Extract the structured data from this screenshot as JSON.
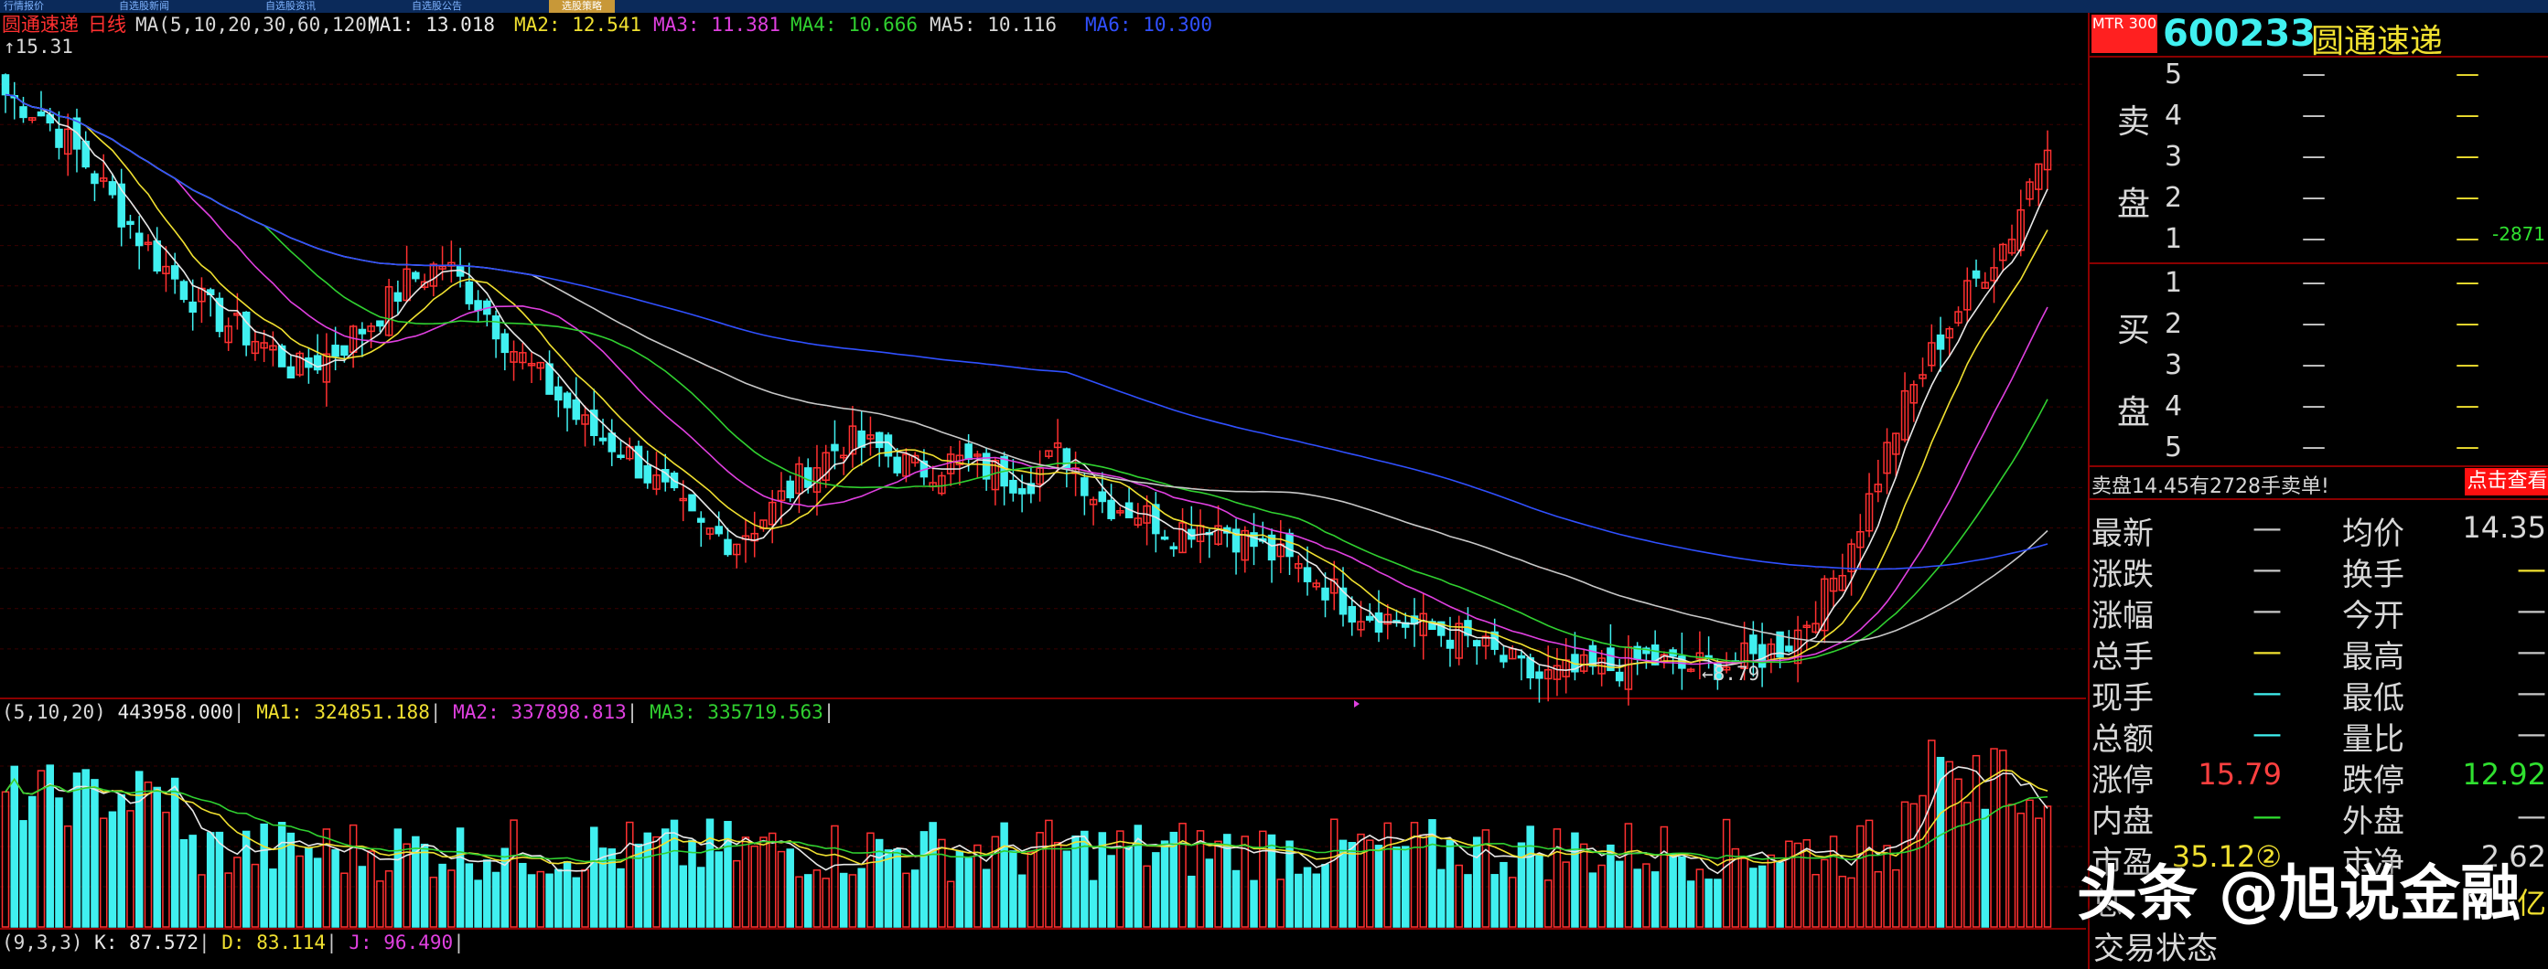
{
  "top_tabs": [
    "行情报价",
    "自选股新闻",
    "自选股资讯",
    "自选股公告",
    "选股策略"
  ],
  "main_legend": {
    "stock": "圆通速递",
    "period": "日线",
    "ma_def": "MA(5,10,20,30,60,120)",
    "ma1": "MA1: 13.018",
    "ma2": "MA2: 12.541",
    "ma3": "MA3: 11.381",
    "ma4": "MA4: 10.666",
    "ma5": "MA5: 10.116",
    "ma6": "MA6: 10.300"
  },
  "price_marks": {
    "high": "15.31",
    "low": "8.79"
  },
  "vol_legend": {
    "def": "(5,10,20)",
    "vol": "443958.000",
    "ma1": "MA1: 324851.188",
    "ma2": "MA2: 337898.813",
    "ma3": "MA3: 335719.563"
  },
  "kdj_legend": {
    "def": "(9,3,3)",
    "k": "K: 87.572",
    "d": "D: 83.114",
    "j": "J: 96.490"
  },
  "colors": {
    "up": "#ff3030",
    "down": "#40f0f0",
    "ma1": "#e8e8e8",
    "ma2": "#f0e030",
    "ma3": "#e040e0",
    "ma4": "#30d030",
    "ma5": "#c8c8c8",
    "ma6": "#3050ff"
  },
  "chart_data": {
    "type": "candlestick",
    "price_range": [
      8.79,
      15.31
    ],
    "close_path_approx": [
      14.8,
      14.6,
      14.2,
      13.7,
      13.2,
      12.8,
      12.5,
      12.3,
      12.0,
      12.2,
      12.5,
      12.9,
      13.1,
      12.7,
      12.2,
      11.8,
      11.4,
      11.2,
      10.8,
      10.4,
      10.3,
      10.6,
      11.0,
      11.3,
      11.2,
      11.0,
      11.1,
      11.0,
      10.9,
      11.2,
      10.7,
      10.6,
      10.4,
      10.5,
      10.3,
      10.1,
      9.9,
      9.6,
      9.5,
      9.4,
      9.3,
      9.1,
      8.9,
      8.95,
      9.0,
      9.1,
      9.0,
      9.05,
      9.1,
      9.3,
      9.8,
      10.6,
      11.6,
      12.3,
      12.9,
      13.4,
      14.4
    ],
    "volume_range": [
      0,
      443958
    ]
  },
  "quote_panel": {
    "badge": "MTR 300",
    "code": "600233",
    "name": "圆通速递",
    "sell_label_1": "卖",
    "sell_label_2": "盘",
    "buy_label_1": "买",
    "buy_label_2": "盘",
    "levels": [
      "5",
      "4",
      "3",
      "2",
      "1"
    ],
    "buy_levels": [
      "1",
      "2",
      "3",
      "4",
      "5"
    ],
    "dash": "—",
    "sell1_change": "-2871",
    "sell_notice": "卖盘14.45有2728手卖单!",
    "check_button": "点击查看",
    "stats": [
      {
        "l1": "最新",
        "v1": "—",
        "c1": "#c8c8c8",
        "l2": "均价",
        "v2": "14.35",
        "c2": "#d8d8d8"
      },
      {
        "l1": "涨跌",
        "v1": "—",
        "c1": "#c8c8c8",
        "l2": "换手",
        "v2": "—",
        "c2": "#f0e030"
      },
      {
        "l1": "涨幅",
        "v1": "—",
        "c1": "#c8c8c8",
        "l2": "今开",
        "v2": "—",
        "c2": "#c8c8c8"
      },
      {
        "l1": "总手",
        "v1": "—",
        "c1": "#f0e030",
        "l2": "最高",
        "v2": "—",
        "c2": "#c8c8c8"
      },
      {
        "l1": "现手",
        "v1": "—",
        "c1": "#40f0f0",
        "l2": "最低",
        "v2": "—",
        "c2": "#c8c8c8"
      },
      {
        "l1": "总额",
        "v1": "—",
        "c1": "#40f0f0",
        "l2": "量比",
        "v2": "—",
        "c2": "#c8c8c8"
      },
      {
        "l1": "涨停",
        "v1": "15.79",
        "c1": "#ff4040",
        "l2": "跌停",
        "v2": "12.92",
        "c2": "#30e030"
      },
      {
        "l1": "内盘",
        "v1": "—",
        "c1": "#30e030",
        "l2": "外盘",
        "v2": "—",
        "c2": "#c8c8c8"
      },
      {
        "l1": "市盈",
        "v1": "35.12②",
        "c1": "#f0e030",
        "l2": "市净",
        "v2": "2.62",
        "c2": "#d8d8d8"
      },
      {
        "l1": "总",
        "v1": "",
        "c1": "#c8c8c8",
        "l2": "",
        "v2": "亿",
        "c2": "#f0e030"
      }
    ],
    "trade_status": "交易状态"
  },
  "watermark": "头条 @旭说金融"
}
